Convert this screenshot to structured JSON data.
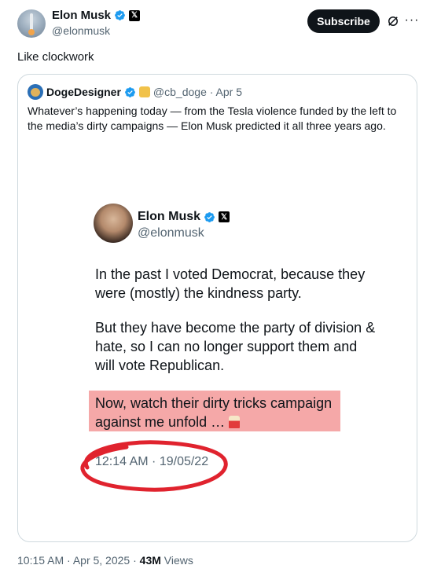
{
  "author": {
    "name": "Elon Musk",
    "handle": "@elonmusk",
    "subscribe_label": "Subscribe",
    "more_glyph": "···"
  },
  "post": {
    "text": "Like clockwork"
  },
  "quote": {
    "name": "DogeDesigner",
    "meta": "@cb_doge · Apr 5",
    "text": "Whatever’s happening today — from the Tesla violence funded by the left to the media’s dirty campaigns — Elon Musk predicted it all three years ago.",
    "embedded": {
      "name": "Elon Musk",
      "handle": "@elonmusk",
      "paragraph1": "In the past I voted Democrat, because they were (mostly) the kindness party.",
      "paragraph2": "But they have become the party of division & hate, so I can no longer support them and will vote Republican.",
      "paragraph3": "Now, watch their dirty tricks campaign against me unfold …",
      "timestamp": "12:14 AM · 19/05/22",
      "highlight_color": "#f5a8a8",
      "annotation_color": "#e0232e"
    }
  },
  "footer": {
    "timestamp": "10:15 AM · Apr 5, 2025 · ",
    "views_count": "43M",
    "views_label": " Views"
  },
  "colors": {
    "verified": "#1d9bf0",
    "secondary_text": "#536471",
    "border": "#cfd9de"
  }
}
